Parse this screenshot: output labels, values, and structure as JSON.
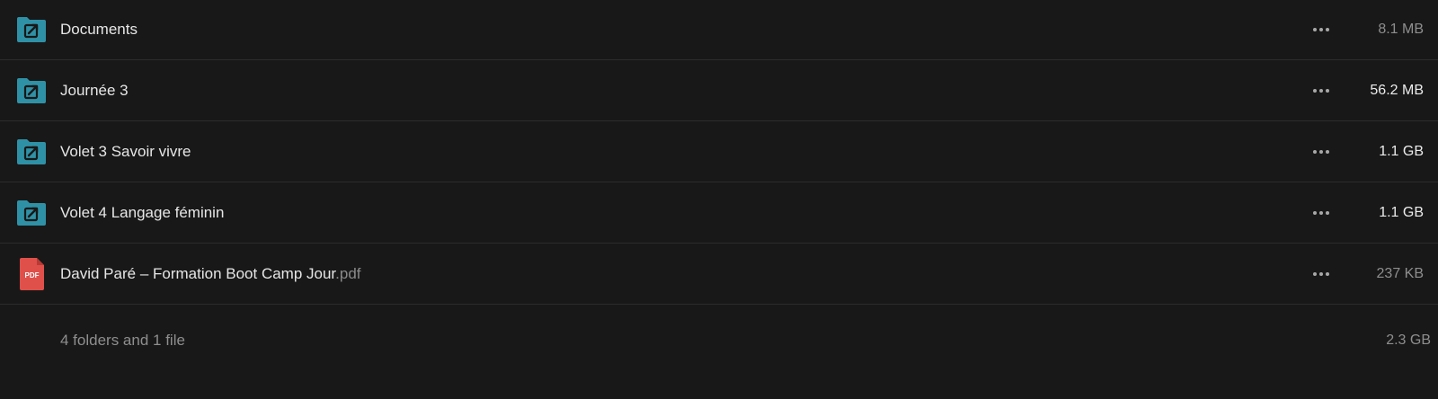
{
  "rows": [
    {
      "name": "Documents",
      "ext": "",
      "size": "8.1 MB",
      "type": "shared-folder"
    },
    {
      "name": "Journée 3",
      "ext": "",
      "size": "56.2 MB",
      "type": "shared-folder"
    },
    {
      "name": "Volet 3 Savoir vivre",
      "ext": "",
      "size": "1.1 GB",
      "type": "shared-folder"
    },
    {
      "name": "Volet 4 Langage féminin",
      "ext": "",
      "size": "1.1 GB",
      "type": "shared-folder"
    },
    {
      "name": "David Paré – Formation Boot Camp Jour",
      "ext": ".pdf",
      "size": "237 KB",
      "type": "pdf"
    }
  ],
  "icons": {
    "folder": "shared-folder-icon",
    "pdf": "pdf-file-icon",
    "pdf_label": "PDF",
    "menu": "more-options-icon"
  },
  "summary": {
    "text": "4 folders and 1 file",
    "total_size": "2.3 GB"
  },
  "colors": {
    "background": "#181818",
    "folder": "#2f91a6",
    "pdf": "#e0504a",
    "divider": "#2c2c2c"
  }
}
